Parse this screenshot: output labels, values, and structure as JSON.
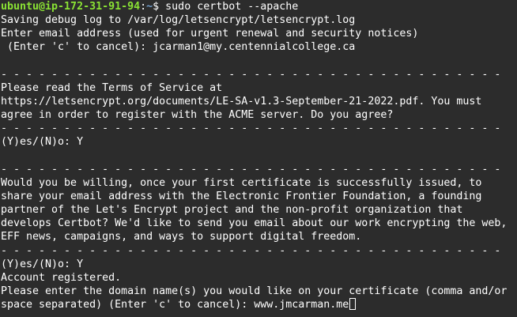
{
  "prompt": {
    "user_host": "ubuntu@ip-172-31-91-94",
    "colon": ":",
    "path": "~",
    "symbol": "$ ",
    "command": "sudo certbot --apache"
  },
  "lines": [
    "Saving debug log to /var/log/letsencrypt/letsencrypt.log",
    "Enter email address (used for urgent renewal and security notices)",
    " (Enter 'c' to cancel): jcarman1@my.centennialcollege.ca",
    "",
    "- - - - - - - - - - - - - - - - - - - - - - - - - - - - - - - - - - - - - - - -",
    "Please read the Terms of Service at",
    "https://letsencrypt.org/documents/LE-SA-v1.3-September-21-2022.pdf. You must",
    "agree in order to register with the ACME server. Do you agree?",
    "- - - - - - - - - - - - - - - - - - - - - - - - - - - - - - - - - - - - - - - -",
    "(Y)es/(N)o: Y",
    "",
    "- - - - - - - - - - - - - - - - - - - - - - - - - - - - - - - - - - - - - - - -",
    "Would you be willing, once your first certificate is successfully issued, to",
    "share your email address with the Electronic Frontier Foundation, a founding",
    "partner of the Let's Encrypt project and the non-profit organization that",
    "develops Certbot? We'd like to send you email about our work encrypting the web,",
    "EFF news, campaigns, and ways to support digital freedom.",
    "- - - - - - - - - - - - - - - - - - - - - - - - - - - - - - - - - - - - - - - -",
    "(Y)es/(N)o: Y",
    "Account registered.",
    "Please enter the domain name(s) you would like on your certificate (comma and/or"
  ],
  "final_line": {
    "prefix": "space separated) (Enter 'c' to cancel): ",
    "input_value": "www.jmcarman.me"
  },
  "colors": {
    "background": "#2c2c2c",
    "text": "#ffffff",
    "user_host": "#8ae234",
    "path": "#729fcf"
  }
}
